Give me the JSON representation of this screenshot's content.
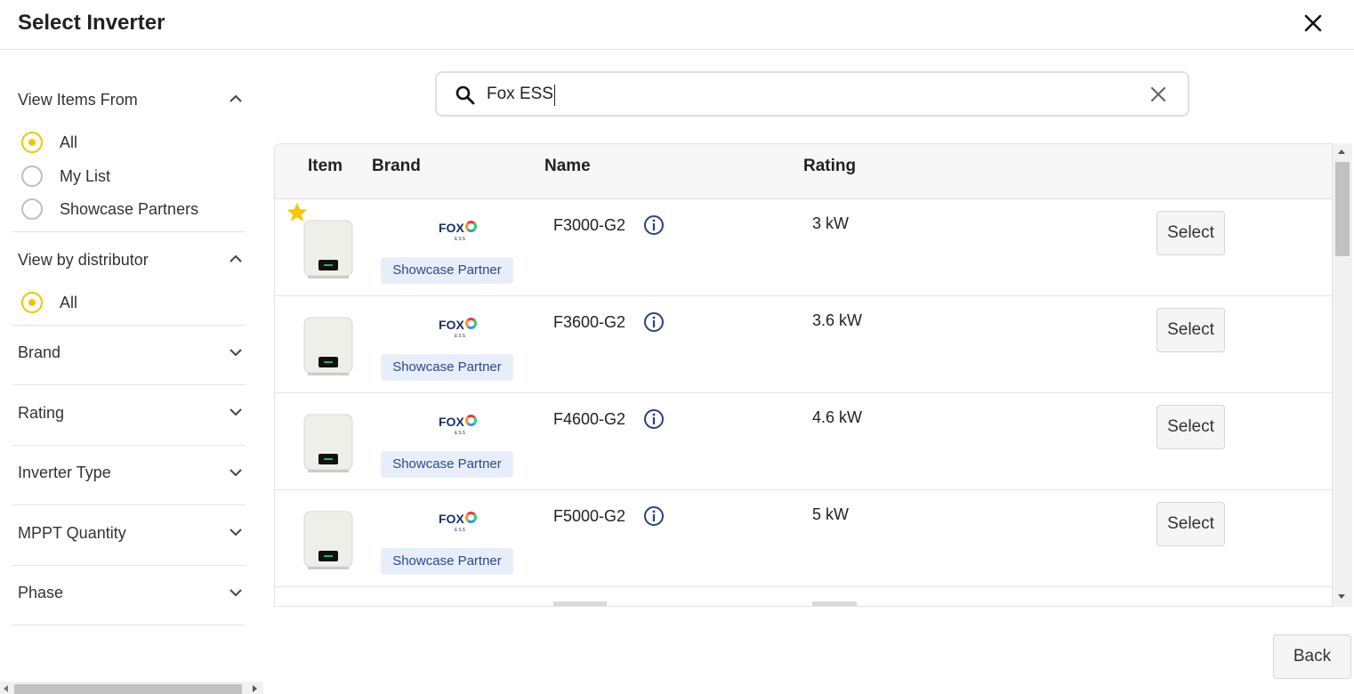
{
  "dialog": {
    "title": "Select Inverter",
    "close_icon": "close-icon"
  },
  "filters": {
    "view_items_from": {
      "title": "View Items From",
      "options": [
        {
          "label": "All",
          "selected": true
        },
        {
          "label": "My List",
          "selected": false
        },
        {
          "label": "Showcase Partners",
          "selected": false
        }
      ]
    },
    "view_by_distributor": {
      "title": "View by distributor",
      "options": [
        {
          "label": "All",
          "selected": true
        }
      ]
    },
    "collapsed": [
      "Brand",
      "Rating",
      "Inverter Type",
      "MPPT Quantity",
      "Phase"
    ]
  },
  "search": {
    "value": "Fox ESS",
    "icon": "search-icon",
    "clear_icon": "clear-icon"
  },
  "table": {
    "columns": [
      "Item",
      "Brand",
      "Name",
      "Rating"
    ],
    "brand_logo": {
      "name": "FOX",
      "sub": "ESS"
    },
    "rows": [
      {
        "name": "F3000-G2",
        "rating": "3 kW",
        "badge": "Showcase Partner",
        "action": "Select",
        "starred": true
      },
      {
        "name": "F3600-G2",
        "rating": "3.6 kW",
        "badge": "Showcase Partner",
        "action": "Select",
        "starred": false
      },
      {
        "name": "F4600-G2",
        "rating": "4.6 kW",
        "badge": "Showcase Partner",
        "action": "Select",
        "starred": false
      },
      {
        "name": "F5000-G2",
        "rating": "5 kW",
        "badge": "Showcase Partner",
        "action": "Select",
        "starred": false
      }
    ]
  },
  "footer": {
    "back_label": "Back"
  },
  "colors": {
    "accent": "#f2c500",
    "badge_bg": "#e8eef9",
    "badge_text": "#274b8e",
    "info_icon": "#27408b"
  }
}
